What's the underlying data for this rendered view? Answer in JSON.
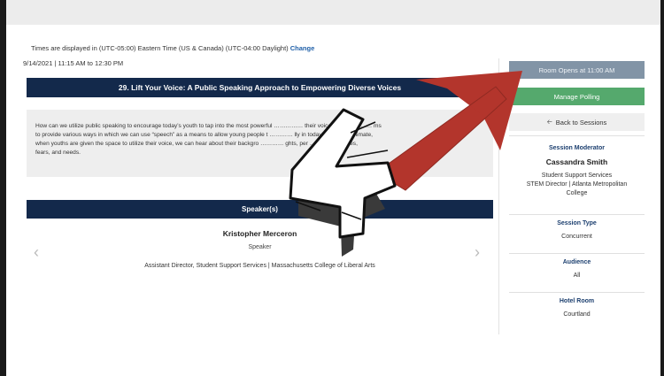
{
  "header": {
    "timezone_text": "Times are displayed in (UTC-05:00) Eastern Time (US & Canada) (UTC-04:00 Daylight)",
    "change_link": "Change",
    "datetime": "9/14/2021 | 11:15 AM to 12:30 PM"
  },
  "session": {
    "title": "29. Lift Your Voice: A Public Speaking Approach to Empowering Diverse Voices",
    "description_lines": [
      "How can we utilize public speaking to encourage today’s youth to tap into the most powerful …………… their voice? This ………… ms",
      "to provide various ways in which we can use “speech” as a means to allow young people t ………… lly in today’s ………… climate,",
      "when youths are given the space to utilize their voice, we can hear about their backgro ………… ghts, per ………… rabilities,",
      "fears, and needs."
    ]
  },
  "speakers": {
    "heading": "Speaker(s)",
    "name": "Kristopher Merceron",
    "role": "Speaker",
    "affiliation": "Assistant Director, Student Support Services | Massachusetts College of Liberal Arts",
    "prev_icon": "chevron-left-icon",
    "next_icon": "chevron-right-icon"
  },
  "sidebar": {
    "room_button": "Room Opens at 11:00 AM",
    "polling_button": "Manage Polling",
    "back_button": "Back to Sessions",
    "moderator_heading": "Session Moderator",
    "moderator_name": "Cassandra Smith",
    "moderator_title_1": "Student Support Services",
    "moderator_title_2": "STEM Director | Atlanta Metropolitan",
    "moderator_title_3": "College",
    "type_heading": "Session Type",
    "type_value": "Concurrent",
    "audience_heading": "Audience",
    "audience_value": "All",
    "room_heading": "Hotel Room",
    "room_value": "Courtland"
  },
  "overlay": {
    "numeral_icon": "hand-drawn-4-icon",
    "arrow_icon": "red-arrow-icon"
  },
  "colors": {
    "navy": "#13294b",
    "room_button": "#8294a6",
    "polling_button": "#55a96d",
    "arrow_red": "#b3352c",
    "link": "#1f5fa8"
  }
}
